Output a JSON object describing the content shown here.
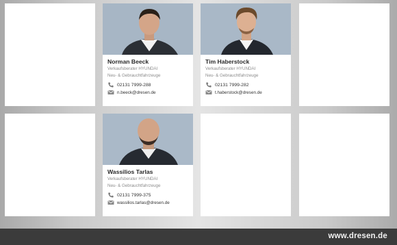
{
  "contacts": [
    {
      "name": "Norman Beeck",
      "role": "Verkaufsberater HYUNDAI",
      "dept": "Neu- & Gebrauchtfahrzeuge",
      "phone": "02131 7999-288",
      "email": "n.beeck@dresen.de"
    },
    {
      "name": "Tim Haberstock",
      "role": "Verkaufsberater HYUNDAI",
      "dept": "Neu- & Gebrauchtfahrzeuge",
      "phone": "02131 7999-282",
      "email": "t.haberstock@dresen.de"
    },
    {
      "name": "Wassilios Tarlas",
      "role": "Verkaufsberater HYUNDAI",
      "dept": "Neu- & Gebrauchtfahrzeuge",
      "phone": "02131 7999-375",
      "email": "wassilios.tarlas@dresen.de"
    }
  ],
  "icons": {
    "phone": "phone-icon",
    "email": "mail-icon"
  },
  "colors": {
    "footer_bg": "#3b3b3b",
    "card_bg": "#ffffff",
    "name_text": "#2a2a2a",
    "sub_text": "#8b8b8b"
  },
  "footer": {
    "site": "www.dresen.de"
  }
}
